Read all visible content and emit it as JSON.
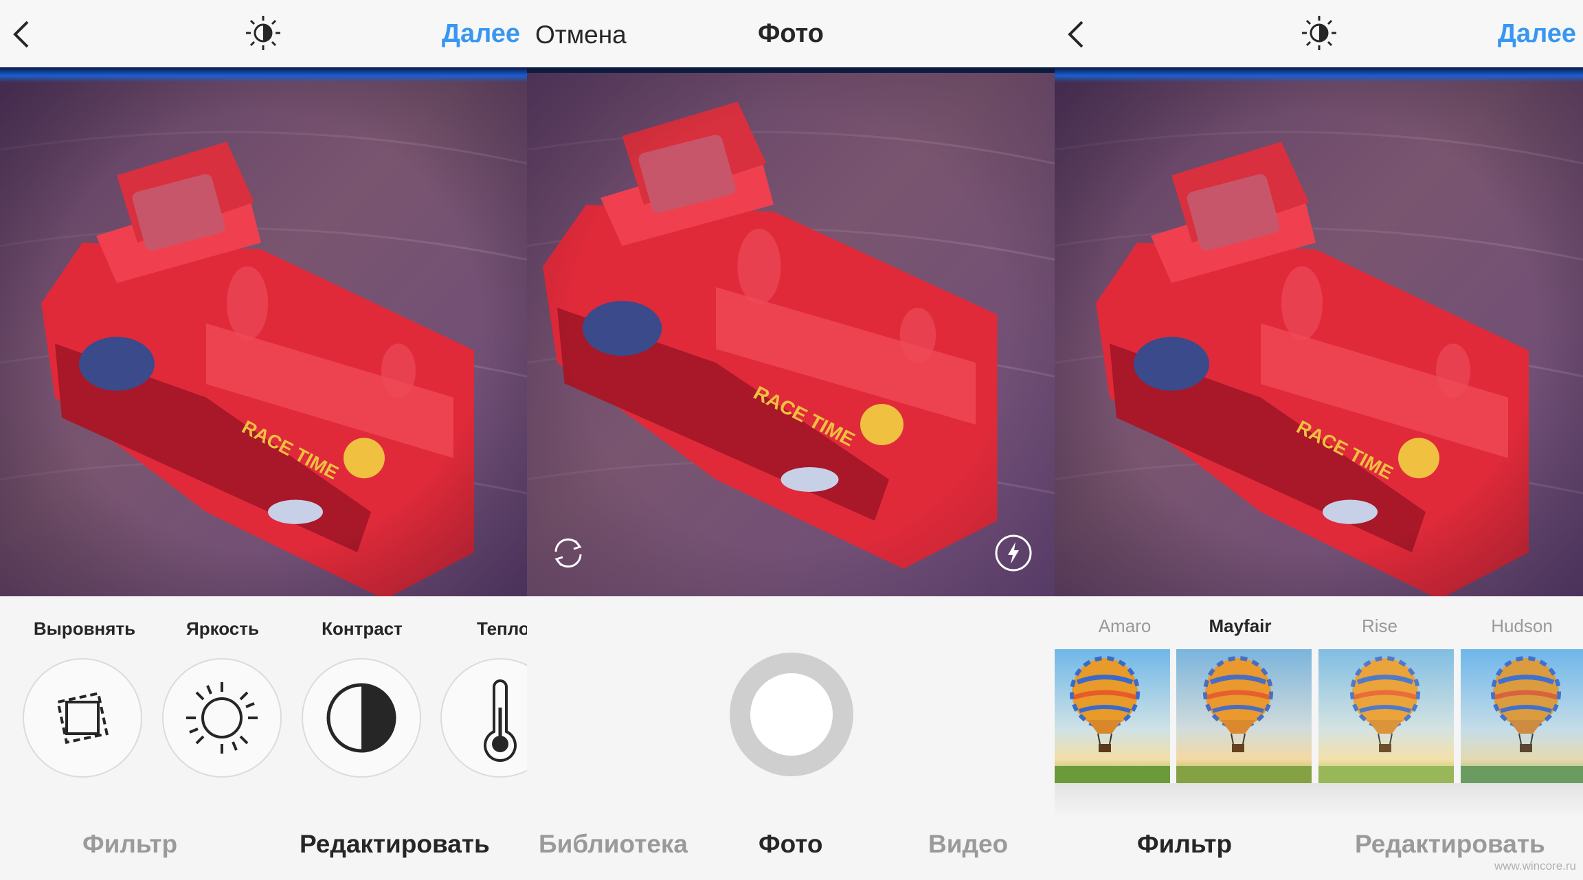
{
  "panel_edit": {
    "next_label": "Далее",
    "tools": [
      {
        "label": "Выровнять",
        "icon": "straighten-icon"
      },
      {
        "label": "Яркость",
        "icon": "sun-icon"
      },
      {
        "label": "Контраст",
        "icon": "contrast-icon"
      },
      {
        "label": "Тепло",
        "icon": "thermometer-icon"
      }
    ],
    "tabs": [
      {
        "label": "Фильтр",
        "active": false
      },
      {
        "label": "Редактировать",
        "active": true
      }
    ]
  },
  "panel_camera": {
    "cancel_label": "Отмена",
    "title": "Фото",
    "tabs": [
      {
        "label": "Библиотека",
        "active": false
      },
      {
        "label": "Фото",
        "active": true
      },
      {
        "label": "Видео",
        "active": false
      }
    ]
  },
  "panel_filter": {
    "next_label": "Далее",
    "filters": [
      {
        "label": "Amaro",
        "selected": false
      },
      {
        "label": "Mayfair",
        "selected": true
      },
      {
        "label": "Rise",
        "selected": false
      },
      {
        "label": "Hudson",
        "selected": false
      }
    ],
    "tabs": [
      {
        "label": "Фильтр",
        "active": true
      },
      {
        "label": "Редактировать",
        "active": false
      }
    ]
  },
  "watermark": "www.wincore.ru",
  "colors": {
    "accent": "#3897f0",
    "text": "#262626",
    "muted": "#9a9a9a",
    "shutter_ring": "#cfcfcf"
  }
}
